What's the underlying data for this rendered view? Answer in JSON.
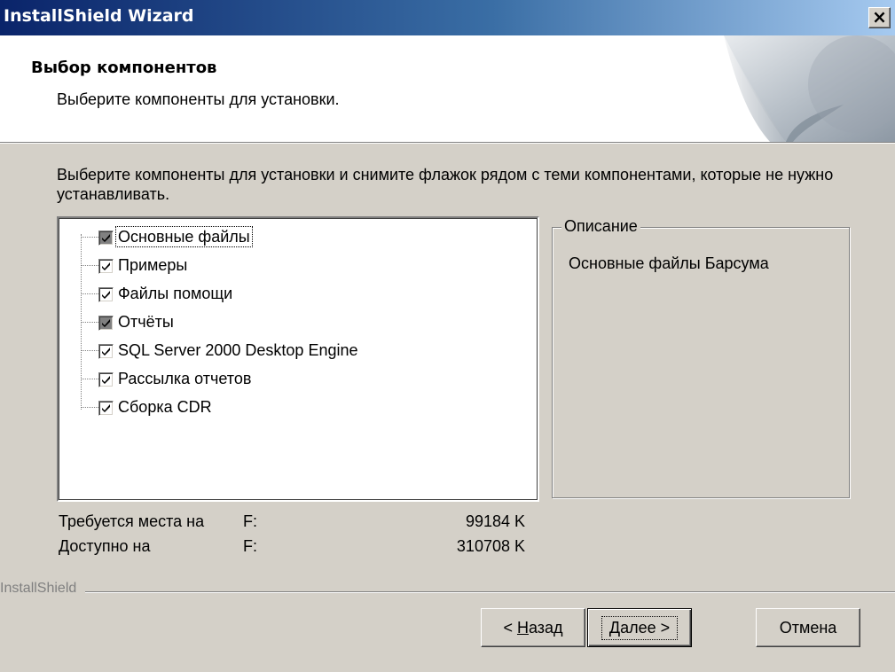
{
  "window": {
    "title": "InstallShield Wizard",
    "close_label": "×"
  },
  "header": {
    "title": "Выбор компонентов",
    "subtitle": "Выберите компоненты для установки."
  },
  "instructions": "Выберите компоненты для установки и снимите флажок рядом с теми компонентами, которые не нужно устанавливать.",
  "components": [
    {
      "label": "Основные файлы",
      "state": "partial",
      "selected": true
    },
    {
      "label": "Примеры",
      "state": "checked",
      "selected": false
    },
    {
      "label": "Файлы помощи",
      "state": "checked",
      "selected": false
    },
    {
      "label": "Отчёты",
      "state": "partial",
      "selected": false
    },
    {
      "label": "SQL Server 2000 Desktop Engine",
      "state": "checked",
      "selected": false
    },
    {
      "label": "Рассылка отчетов",
      "state": "checked",
      "selected": false
    },
    {
      "label": "Сборка CDR",
      "state": "checked",
      "selected": false
    }
  ],
  "description": {
    "legend": "Описание",
    "text": "Основные файлы Барсума"
  },
  "space": {
    "required_label": "Требуется места на",
    "required_drive": "F:",
    "required_value": "99184 K",
    "available_label": "Доступно на",
    "available_drive": "F:",
    "available_value": "310708 K"
  },
  "brand": "InstallShield",
  "buttons": {
    "back_prefix": "< ",
    "back_hotkey": "Н",
    "back_rest": "азад",
    "next_hotkey": "Д",
    "next_rest": "алее >",
    "cancel": "Отмена"
  }
}
